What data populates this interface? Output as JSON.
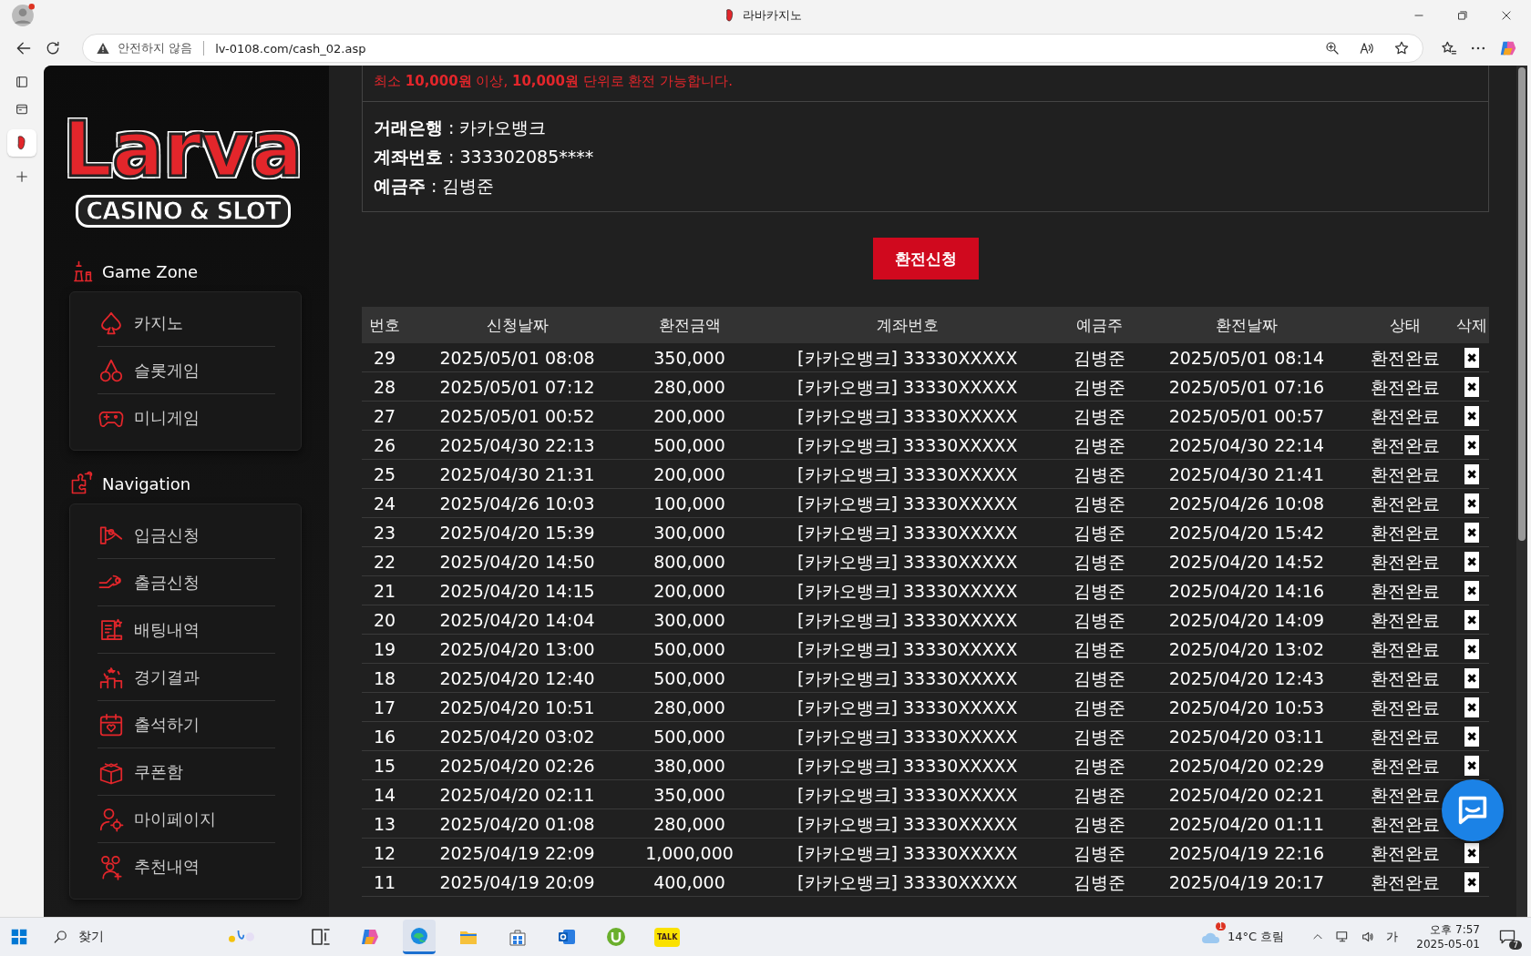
{
  "browser": {
    "tab_title": "라바카지노",
    "security": "안전하지 않음",
    "url": "lv-0108.com/cash_02.asp"
  },
  "logo": {
    "word": "Larva",
    "tagline": "CASINO & SLOT"
  },
  "sidebar": {
    "sections": [
      {
        "title": "Game Zone",
        "items": [
          {
            "label": "카지노"
          },
          {
            "label": "슬롯게임"
          },
          {
            "label": "미니게임"
          }
        ]
      },
      {
        "title": "Navigation",
        "items": [
          {
            "label": "입금신청"
          },
          {
            "label": "출금신청"
          },
          {
            "label": "배팅내역"
          },
          {
            "label": "경기결과"
          },
          {
            "label": "출석하기"
          },
          {
            "label": "쿠폰함"
          },
          {
            "label": "마이페이지"
          },
          {
            "label": "추천내역"
          }
        ]
      }
    ]
  },
  "notice": "최소 **10,000원** 이상, **10,000원** 단위로 환전 가능합니다.",
  "bank_info": [
    "**거래은행** : 카카오뱅크",
    "**계좌번호** : 333302085****",
    "**예금주** : 김병준"
  ],
  "submit_button": "환전신청",
  "table": {
    "columns": [
      "번호",
      "신청날짜",
      "환전금액",
      "계좌번호",
      "예금주",
      "환전날짜",
      "상태",
      "삭제"
    ],
    "rows": [
      [
        "29",
        "2025/05/01 08:08",
        "350,000",
        "[카카오뱅크] 33330XXXXX",
        "김병준",
        "2025/05/01 08:14",
        "환전완료",
        "✖"
      ],
      [
        "28",
        "2025/05/01 07:12",
        "280,000",
        "[카카오뱅크] 33330XXXXX",
        "김병준",
        "2025/05/01 07:16",
        "환전완료",
        "✖"
      ],
      [
        "27",
        "2025/05/01 00:52",
        "200,000",
        "[카카오뱅크] 33330XXXXX",
        "김병준",
        "2025/05/01 00:57",
        "환전완료",
        "✖"
      ],
      [
        "26",
        "2025/04/30 22:13",
        "500,000",
        "[카카오뱅크] 33330XXXXX",
        "김병준",
        "2025/04/30 22:14",
        "환전완료",
        "✖"
      ],
      [
        "25",
        "2025/04/30 21:31",
        "200,000",
        "[카카오뱅크] 33330XXXXX",
        "김병준",
        "2025/04/30 21:41",
        "환전완료",
        "✖"
      ],
      [
        "24",
        "2025/04/26 10:03",
        "100,000",
        "[카카오뱅크] 33330XXXXX",
        "김병준",
        "2025/04/26 10:08",
        "환전완료",
        "✖"
      ],
      [
        "23",
        "2025/04/20 15:39",
        "300,000",
        "[카카오뱅크] 33330XXXXX",
        "김병준",
        "2025/04/20 15:42",
        "환전완료",
        "✖"
      ],
      [
        "22",
        "2025/04/20 14:50",
        "800,000",
        "[카카오뱅크] 33330XXXXX",
        "김병준",
        "2025/04/20 14:52",
        "환전완료",
        "✖"
      ],
      [
        "21",
        "2025/04/20 14:15",
        "200,000",
        "[카카오뱅크] 33330XXXXX",
        "김병준",
        "2025/04/20 14:16",
        "환전완료",
        "✖"
      ],
      [
        "20",
        "2025/04/20 14:04",
        "300,000",
        "[카카오뱅크] 33330XXXXX",
        "김병준",
        "2025/04/20 14:09",
        "환전완료",
        "✖"
      ],
      [
        "19",
        "2025/04/20 13:00",
        "500,000",
        "[카카오뱅크] 33330XXXXX",
        "김병준",
        "2025/04/20 13:02",
        "환전완료",
        "✖"
      ],
      [
        "18",
        "2025/04/20 12:40",
        "500,000",
        "[카카오뱅크] 33330XXXXX",
        "김병준",
        "2025/04/20 12:43",
        "환전완료",
        "✖"
      ],
      [
        "17",
        "2025/04/20 10:51",
        "280,000",
        "[카카오뱅크] 33330XXXXX",
        "김병준",
        "2025/04/20 10:53",
        "환전완료",
        "✖"
      ],
      [
        "16",
        "2025/04/20 03:02",
        "500,000",
        "[카카오뱅크] 33330XXXXX",
        "김병준",
        "2025/04/20 03:11",
        "환전완료",
        "✖"
      ],
      [
        "15",
        "2025/04/20 02:26",
        "380,000",
        "[카카오뱅크] 33330XXXXX",
        "김병준",
        "2025/04/20 02:29",
        "환전완료",
        "✖"
      ],
      [
        "14",
        "2025/04/20 02:11",
        "350,000",
        "[카카오뱅크] 33330XXXXX",
        "김병준",
        "2025/04/20 02:21",
        "환전완료"
      ],
      [
        "13",
        "2025/04/20 01:08",
        "280,000",
        "[카카오뱅크] 33330XXXXX",
        "김병준",
        "2025/04/20 01:11",
        "환전완료"
      ],
      [
        "12",
        "2025/04/19 22:09",
        "1,000,000",
        "[카카오뱅크] 33330XXXXX",
        "김병준",
        "2025/04/19 22:16",
        "환전완료",
        "✖"
      ],
      [
        "11",
        "2025/04/19 20:09",
        "400,000",
        "[카카오뱅크] 33330XXXXX",
        "김병준",
        "2025/04/19 20:17",
        "환전완료",
        "✖"
      ]
    ]
  },
  "taskbar": {
    "search": "찾기",
    "weather": "14°C 흐림",
    "weather_badge": "1",
    "ime": "가",
    "time": "오후 7:57",
    "date": "2025-05-01",
    "notifications": "7",
    "talk_label": "TALK"
  }
}
